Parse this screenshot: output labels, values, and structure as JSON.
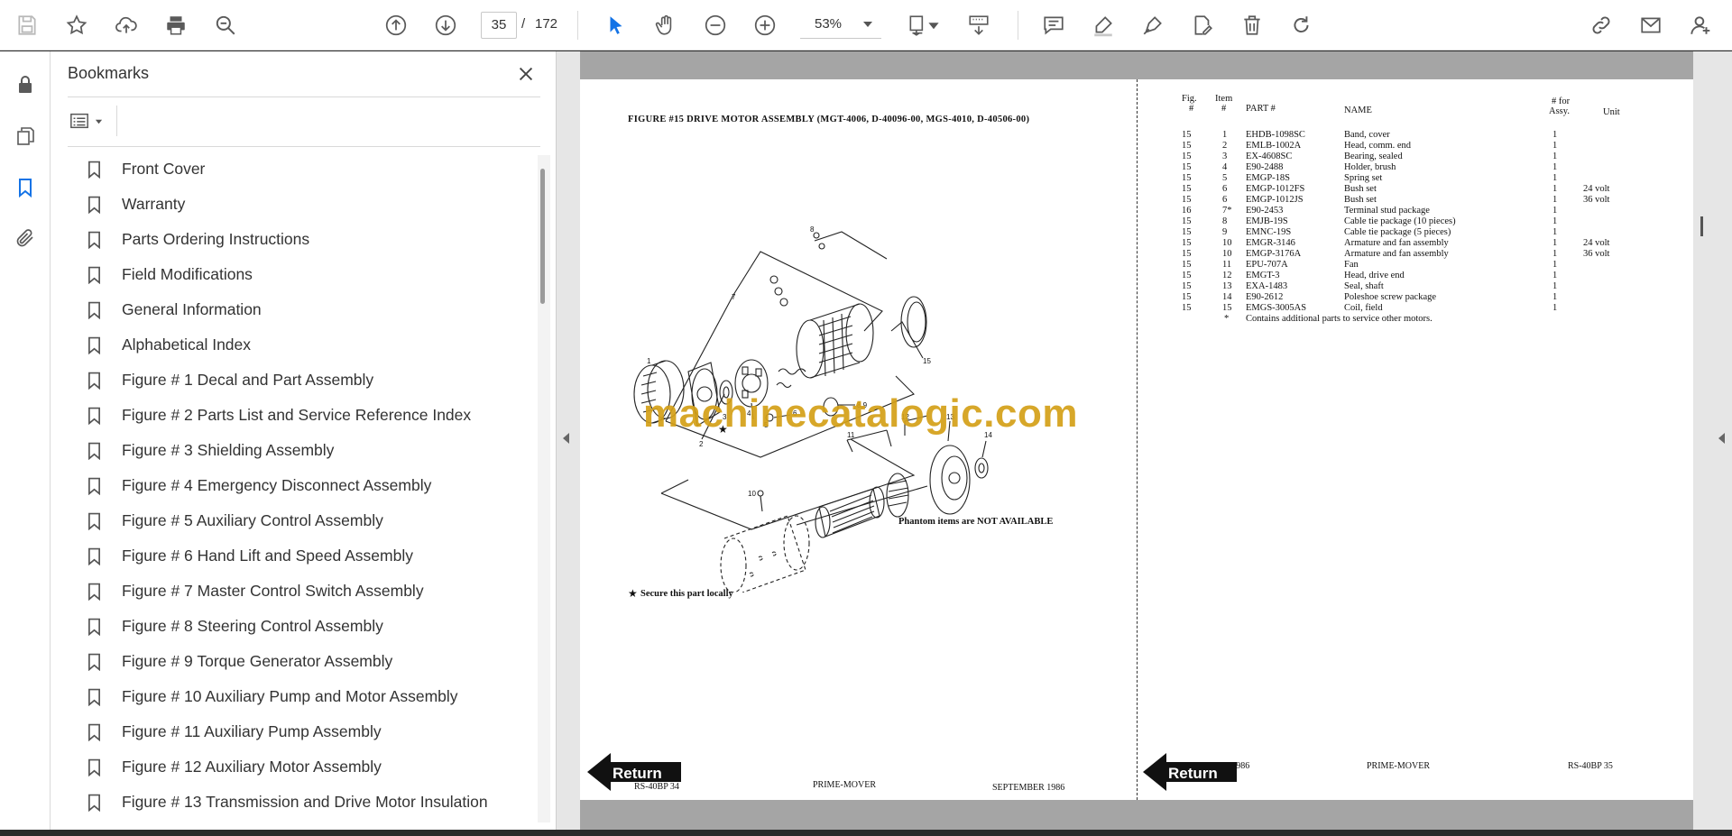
{
  "toolbar": {
    "current_page": "35",
    "page_separator": "/",
    "total_pages": "172",
    "zoom": "53%"
  },
  "bookmarks": {
    "title": "Bookmarks",
    "items": [
      "Front Cover",
      "Warranty",
      "Parts Ordering Instructions",
      "Field Modifications",
      "General Information",
      "Alphabetical Index",
      "Figure # 1 Decal and Part Assembly",
      "Figure # 2 Parts List and Service Reference Index",
      "Figure # 3 Shielding Assembly",
      "Figure # 4 Emergency Disconnect Assembly",
      "Figure # 5 Auxiliary Control Assembly",
      "Figure # 6 Hand Lift and Speed Assembly",
      "Figure # 7 Master Control Switch Assembly",
      "Figure # 8 Steering Control Assembly",
      "Figure # 9 Torque Generator Assembly",
      "Figure # 10 Auxiliary Pump and Motor Assembly",
      "Figure # 11 Auxiliary Pump Assembly",
      "Figure # 12 Auxiliary Motor Assembly",
      "Figure # 13 Transmission and Drive Motor Insulation"
    ]
  },
  "document": {
    "figure_title": "FIGURE #15 DRIVE MOTOR ASSEMBLY (MGT-4006, D-40096-00, MGS-4010, D-40506-00)",
    "phantom_note": "Phantom items are NOT AVAILABLE",
    "secure_star": "★",
    "secure_note": "Secure this part locally",
    "watermark": "machinecatalogic.com",
    "return_label": "Return",
    "footer_left_page": "RS-40BP 34",
    "footer_left_center": "PRIME-MOVER",
    "footer_left_date": "SEPTEMBER 1986",
    "footer_right_date": "SEPTEMBER 1986",
    "footer_right_center": "PRIME-MOVER",
    "footer_right_page": "RS-40BP 35",
    "diagram_labels": [
      "1",
      "2",
      "3",
      "4",
      "5",
      "6",
      "7",
      "8",
      "8,9",
      "10",
      "11",
      "12",
      "13",
      "14",
      "15"
    ],
    "table_headers": {
      "fig_top": "Fig.",
      "fig_bottom": "#",
      "item_top": "Item",
      "item_bottom": "#",
      "part": "PART #",
      "name": "NAME",
      "for_top": "# for",
      "for_bottom": "Assy.",
      "unit": "Unit"
    },
    "parts": [
      {
        "fig": "15",
        "item": "1",
        "part": "EHDB-1098SC",
        "name": "Band, cover",
        "qty": "1",
        "unit": ""
      },
      {
        "fig": "15",
        "item": "2",
        "part": "EMLB-1002A",
        "name": "Head, comm. end",
        "qty": "1",
        "unit": ""
      },
      {
        "fig": "15",
        "item": "3",
        "part": "EX-4608SC",
        "name": "Bearing, sealed",
        "qty": "1",
        "unit": ""
      },
      {
        "fig": "15",
        "item": "4",
        "part": "E90-2488",
        "name": "Holder, brush",
        "qty": "1",
        "unit": ""
      },
      {
        "fig": "15",
        "item": "5",
        "part": "EMGP-18S",
        "name": "Spring set",
        "qty": "1",
        "unit": ""
      },
      {
        "fig": "15",
        "item": "6",
        "part": "EMGP-1012FS",
        "name": "Bush set",
        "qty": "1",
        "unit": "24 volt"
      },
      {
        "fig": "15",
        "item": "6",
        "part": "EMGP-1012JS",
        "name": "Bush set",
        "qty": "1",
        "unit": "36 volt"
      },
      {
        "fig": "16",
        "item": "7*",
        "part": "E90-2453",
        "name": "Terminal stud package",
        "qty": "1",
        "unit": ""
      },
      {
        "fig": "15",
        "item": "8",
        "part": "EMJB-19S",
        "name": "Cable tie package (10 pieces)",
        "qty": "1",
        "unit": ""
      },
      {
        "fig": "15",
        "item": "9",
        "part": "EMNC-19S",
        "name": "Cable tie package (5 pieces)",
        "qty": "1",
        "unit": ""
      },
      {
        "fig": "15",
        "item": "10",
        "part": "EMGR-3146",
        "name": "Armature and fan assembly",
        "qty": "1",
        "unit": "24 volt"
      },
      {
        "fig": "15",
        "item": "10",
        "part": "EMGP-3176A",
        "name": "Armature and fan assembly",
        "qty": "1",
        "unit": "36 volt"
      },
      {
        "fig": "15",
        "item": "11",
        "part": "EPU-707A",
        "name": "Fan",
        "qty": "1",
        "unit": ""
      },
      {
        "fig": "15",
        "item": "12",
        "part": "EMGT-3",
        "name": "Head, drive end",
        "qty": "1",
        "unit": ""
      },
      {
        "fig": "15",
        "item": "13",
        "part": "EXA-1483",
        "name": "Seal, shaft",
        "qty": "1",
        "unit": ""
      },
      {
        "fig": "15",
        "item": "14",
        "part": "E90-2612",
        "name": "Poleshoe screw package",
        "qty": "1",
        "unit": ""
      },
      {
        "fig": "15",
        "item": "15",
        "part": "EMGS-3005AS",
        "name": "Coil, field",
        "qty": "1",
        "unit": ""
      }
    ],
    "footnote_mark": "*",
    "footnote": "Contains additional parts to service other motors."
  }
}
